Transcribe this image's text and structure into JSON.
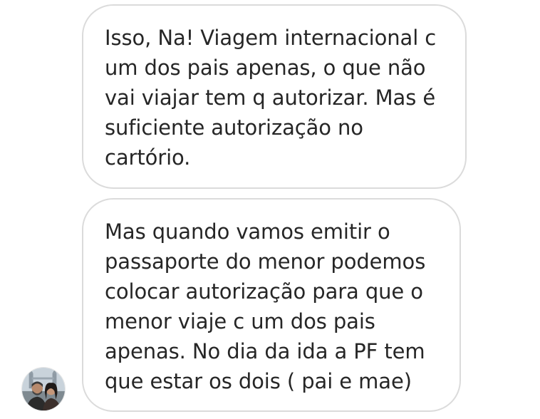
{
  "conversation": {
    "messages": [
      {
        "lines": [
          "Isso, Na! Viagem internacional c",
          "um dos pais apenas, o que não",
          "vai viajar tem q autorizar. Mas é",
          "suficiente autorização no",
          "cartório."
        ]
      },
      {
        "lines": [
          "Mas quando vamos emitir o",
          "passaporte do menor podemos",
          "colocar autorização para que o",
          "menor viaje c um dos pais",
          "apenas. No dia da ida a PF tem",
          "que estar os dois ( pai e mae)"
        ]
      }
    ],
    "avatar_icon": "profile-photo-couple-london-bridge",
    "colors": {
      "bubble_border": "#dbdbdb",
      "text": "#262626",
      "background": "#ffffff"
    }
  }
}
